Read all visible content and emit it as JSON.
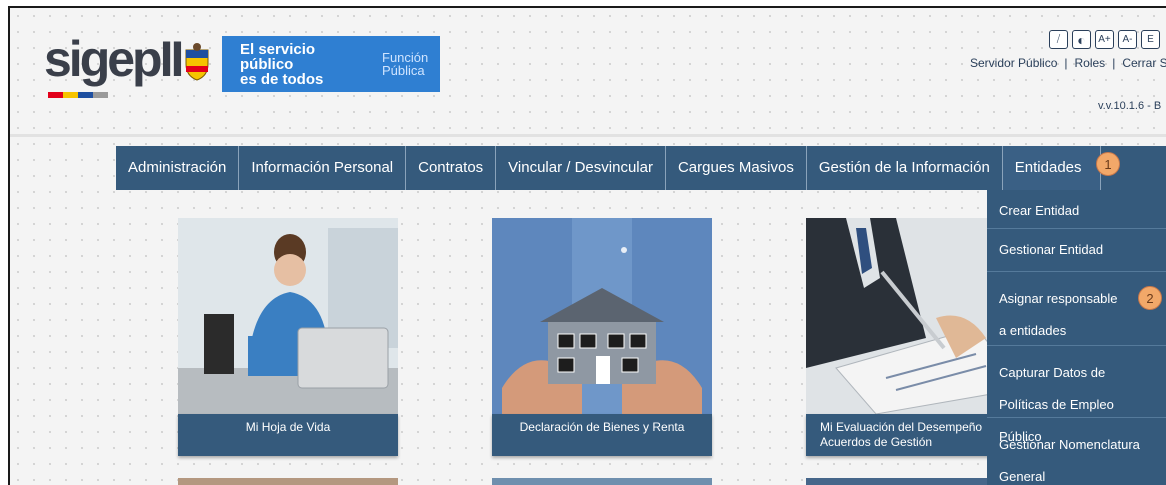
{
  "header": {
    "logo_text": "sigepII",
    "logo_colors": [
      "#e2001a",
      "#f6c400",
      "#1e4fa0",
      "#9a9a9a"
    ],
    "slogan": "El servicio público\nes de todos",
    "institution": "Función\nPública",
    "accessibility_buttons": [
      {
        "icon": "rss-icon",
        "label": "⧸"
      },
      {
        "icon": "contrast-icon",
        "label": "◐"
      },
      {
        "icon": "font-increase-icon",
        "label": "A+"
      },
      {
        "icon": "font-decrease-icon",
        "label": "A-"
      },
      {
        "icon": "font-reset-icon",
        "label": "E"
      }
    ],
    "links": [
      "Servidor Público",
      "Roles",
      "Cerrar Ses"
    ],
    "version": "v.v.10.1.6 - B"
  },
  "nav": {
    "items": [
      "Administración",
      "Información Personal",
      "Contratos",
      "Vincular / Desvincular",
      "Cargues Masivos",
      "Gestión de la Información",
      "Entidades"
    ],
    "badge": "1"
  },
  "cards": [
    {
      "caption": "Mi Hoja de Vida"
    },
    {
      "caption": "Declaración de Bienes y Renta"
    },
    {
      "caption": "Mi Evaluación del Desempeño\nAcuerdos de Gestión"
    }
  ],
  "dropdown": {
    "items": [
      "Crear Entidad",
      "Gestionar Entidad",
      "Asignar responsable a entidades",
      "Capturar Datos de Políticas de Empleo Público",
      "Gestionar Nomenclatura General"
    ],
    "badge": "2"
  },
  "colors": {
    "nav_bg": "#355a7c",
    "gov_blue": "#2f7fd2",
    "badge_orange": "#f2a869"
  }
}
